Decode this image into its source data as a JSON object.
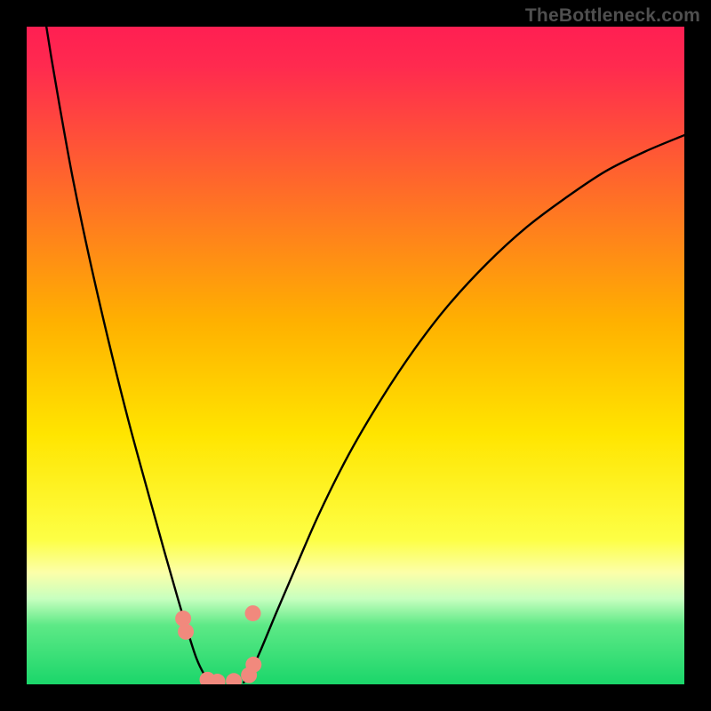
{
  "watermark": "TheBottleneck.com",
  "chart_data": {
    "type": "line",
    "title": "",
    "xlabel": "",
    "ylabel": "",
    "x_range": [
      0,
      100
    ],
    "y_range": [
      0,
      100
    ],
    "gradient_stops": [
      {
        "pos": 0.0,
        "color": "#ff1f52"
      },
      {
        "pos": 0.06,
        "color": "#ff2a4f"
      },
      {
        "pos": 0.45,
        "color": "#ffb100"
      },
      {
        "pos": 0.62,
        "color": "#ffe500"
      },
      {
        "pos": 0.78,
        "color": "#fdff45"
      },
      {
        "pos": 0.83,
        "color": "#fcffa9"
      },
      {
        "pos": 0.87,
        "color": "#c7ffbf"
      },
      {
        "pos": 0.91,
        "color": "#5de986"
      },
      {
        "pos": 1.0,
        "color": "#1bd66a"
      }
    ],
    "series": [
      {
        "name": "left-curve",
        "stroke": "#000000",
        "points": [
          {
            "x": 3.0,
            "y": 100.0
          },
          {
            "x": 3.8,
            "y": 95.0
          },
          {
            "x": 5.0,
            "y": 88.0
          },
          {
            "x": 7.0,
            "y": 77.0
          },
          {
            "x": 9.5,
            "y": 65.0
          },
          {
            "x": 12.5,
            "y": 52.0
          },
          {
            "x": 15.5,
            "y": 40.0
          },
          {
            "x": 18.5,
            "y": 29.0
          },
          {
            "x": 21.0,
            "y": 20.0
          },
          {
            "x": 23.0,
            "y": 13.0
          },
          {
            "x": 24.5,
            "y": 8.0
          },
          {
            "x": 25.8,
            "y": 4.0
          },
          {
            "x": 27.0,
            "y": 1.5
          },
          {
            "x": 28.0,
            "y": 0.3
          }
        ]
      },
      {
        "name": "right-curve",
        "stroke": "#000000",
        "points": [
          {
            "x": 33.0,
            "y": 0.3
          },
          {
            "x": 34.0,
            "y": 1.8
          },
          {
            "x": 35.5,
            "y": 5.0
          },
          {
            "x": 38.0,
            "y": 11.0
          },
          {
            "x": 41.0,
            "y": 18.0
          },
          {
            "x": 44.5,
            "y": 26.0
          },
          {
            "x": 49.0,
            "y": 35.0
          },
          {
            "x": 54.0,
            "y": 43.5
          },
          {
            "x": 59.0,
            "y": 51.0
          },
          {
            "x": 64.0,
            "y": 57.5
          },
          {
            "x": 70.0,
            "y": 64.0
          },
          {
            "x": 76.0,
            "y": 69.5
          },
          {
            "x": 82.0,
            "y": 74.0
          },
          {
            "x": 88.0,
            "y": 78.0
          },
          {
            "x": 94.0,
            "y": 81.0
          },
          {
            "x": 100.0,
            "y": 83.5
          }
        ]
      }
    ],
    "markers": {
      "color": "#f1897d",
      "radius": 9,
      "points": [
        {
          "x": 23.8,
          "y": 10.0
        },
        {
          "x": 24.2,
          "y": 8.0
        },
        {
          "x": 27.5,
          "y": 0.7
        },
        {
          "x": 29.0,
          "y": 0.4
        },
        {
          "x": 31.5,
          "y": 0.5
        },
        {
          "x": 33.8,
          "y": 1.4
        },
        {
          "x": 34.5,
          "y": 3.0
        },
        {
          "x": 34.4,
          "y": 10.8
        }
      ]
    }
  }
}
